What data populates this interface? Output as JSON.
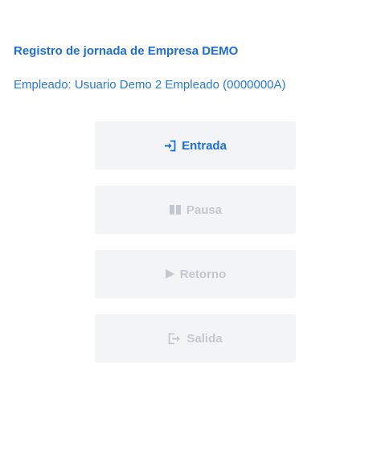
{
  "header": {
    "title": "Registro de jornada de Empresa DEMO",
    "employee": "Empleado: Usuario Demo 2 Empleado (0000000A)"
  },
  "actions": [
    {
      "label": "Entrada",
      "icon": "sign-in-icon",
      "state": "enabled"
    },
    {
      "label": "Pausa",
      "icon": "pause-icon",
      "state": "disabled"
    },
    {
      "label": "Retorno",
      "icon": "play-icon",
      "state": "disabled"
    },
    {
      "label": "Salida",
      "icon": "sign-out-icon",
      "state": "disabled"
    }
  ],
  "colors": {
    "accent": "#1f6fd1",
    "button_bg": "#f3f4f6",
    "disabled_text": "#c3c8cf"
  }
}
